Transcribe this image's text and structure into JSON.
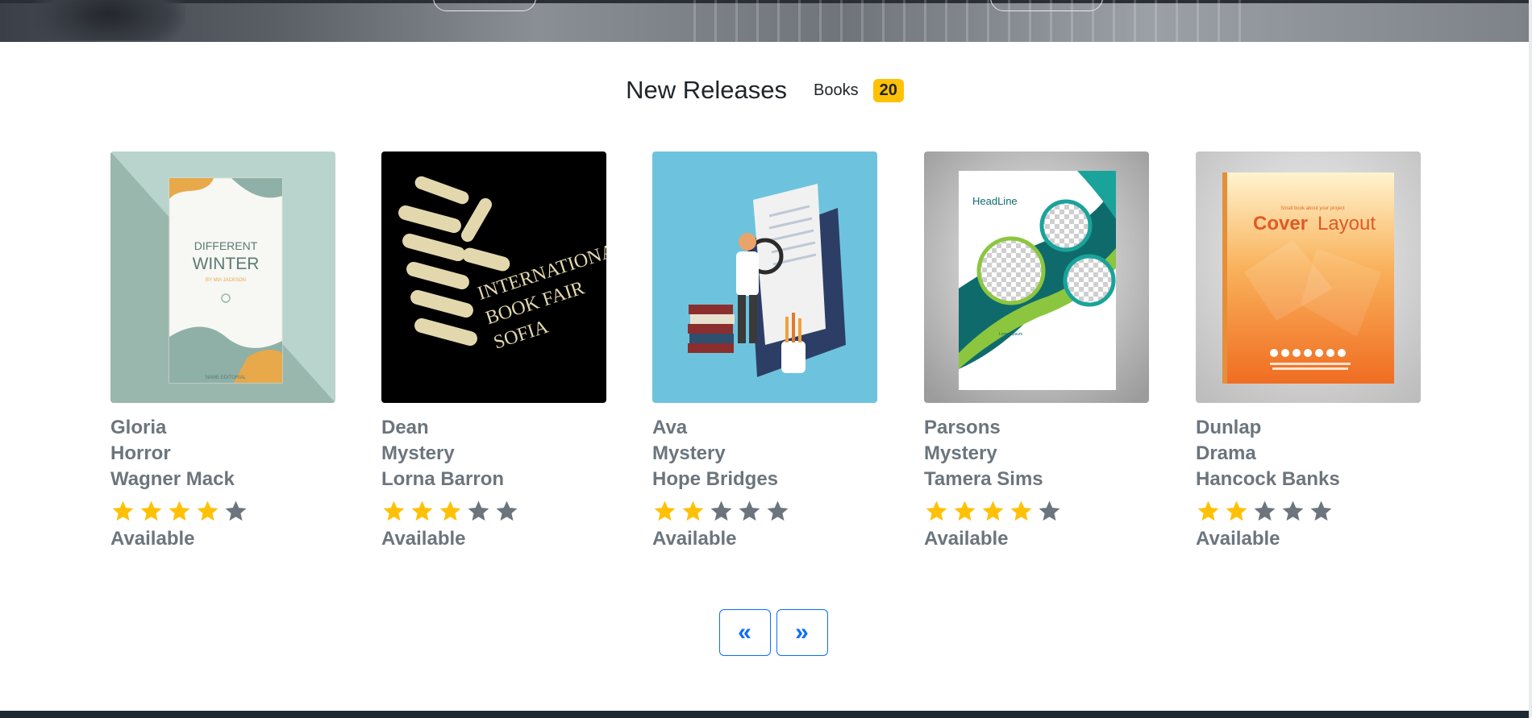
{
  "section": {
    "title": "New Releases",
    "books_label": "Books",
    "count": "20"
  },
  "colors": {
    "star_on": "#ffc107",
    "star_off": "#6c757d",
    "badge": "#ffc107",
    "pager_accent": "#0d6efd"
  },
  "books": [
    {
      "title": "Gloria",
      "genre": "Horror",
      "author": "Wagner Mack",
      "rating": 4,
      "status": "Available",
      "cover": {
        "type": "different-winter",
        "line1": "DIFFERENT",
        "line2": "WINTER",
        "line3": "BY MIA JACKSON",
        "line4": "NAME EDITORIAL"
      }
    },
    {
      "title": "Dean",
      "genre": "Mystery",
      "author": "Lorna Barron",
      "rating": 3,
      "status": "Available",
      "cover": {
        "type": "book-fair",
        "line1": "INTERNATIONAL",
        "line2": "BOOK FAIR",
        "line3": "SOFIA"
      }
    },
    {
      "title": "Ava",
      "genre": "Mystery",
      "author": "Hope Bridges",
      "rating": 2,
      "status": "Available",
      "cover": {
        "type": "reader-illustration"
      }
    },
    {
      "title": "Parsons",
      "genre": "Mystery",
      "author": "Tamera Sims",
      "rating": 4,
      "status": "Available",
      "cover": {
        "type": "headline",
        "line1": "HeadLine",
        "line2": "Lorem Ipsum"
      }
    },
    {
      "title": "Dunlap",
      "genre": "Drama",
      "author": "Hancock Banks",
      "rating": 2,
      "status": "Available",
      "cover": {
        "type": "cover-layout",
        "line1": "Small book about your project",
        "line2": "Cover",
        "line3": "Layout"
      }
    }
  ],
  "pager": {
    "prev_glyph": "«",
    "next_glyph": "»"
  }
}
